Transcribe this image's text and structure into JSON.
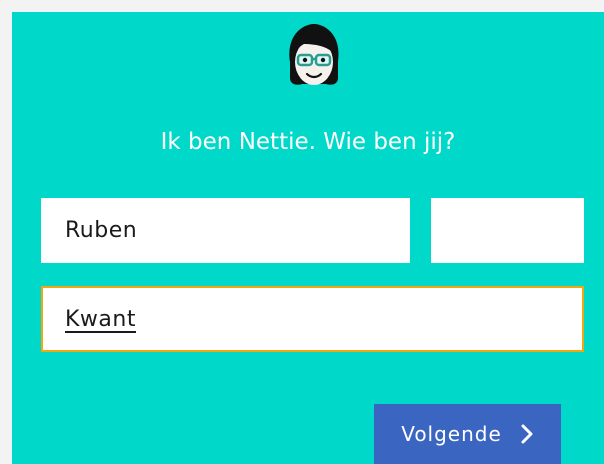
{
  "greeting": "Ik ben Nettie. Wie ben jij?",
  "avatar": {
    "icon": "girl-with-glasses-avatar-icon"
  },
  "form": {
    "first_name": {
      "value": "Ruben",
      "placeholder": ""
    },
    "middle_name": {
      "value": "",
      "placeholder": ""
    },
    "last_name": {
      "value": "Kwant",
      "placeholder": ""
    }
  },
  "next_button": {
    "label": "Volgende",
    "icon": "chevron-right-icon"
  },
  "colors": {
    "background": "#00d9c9",
    "button": "#3a66c1",
    "focus_border": "#f3a610",
    "field": "#ffffff"
  }
}
